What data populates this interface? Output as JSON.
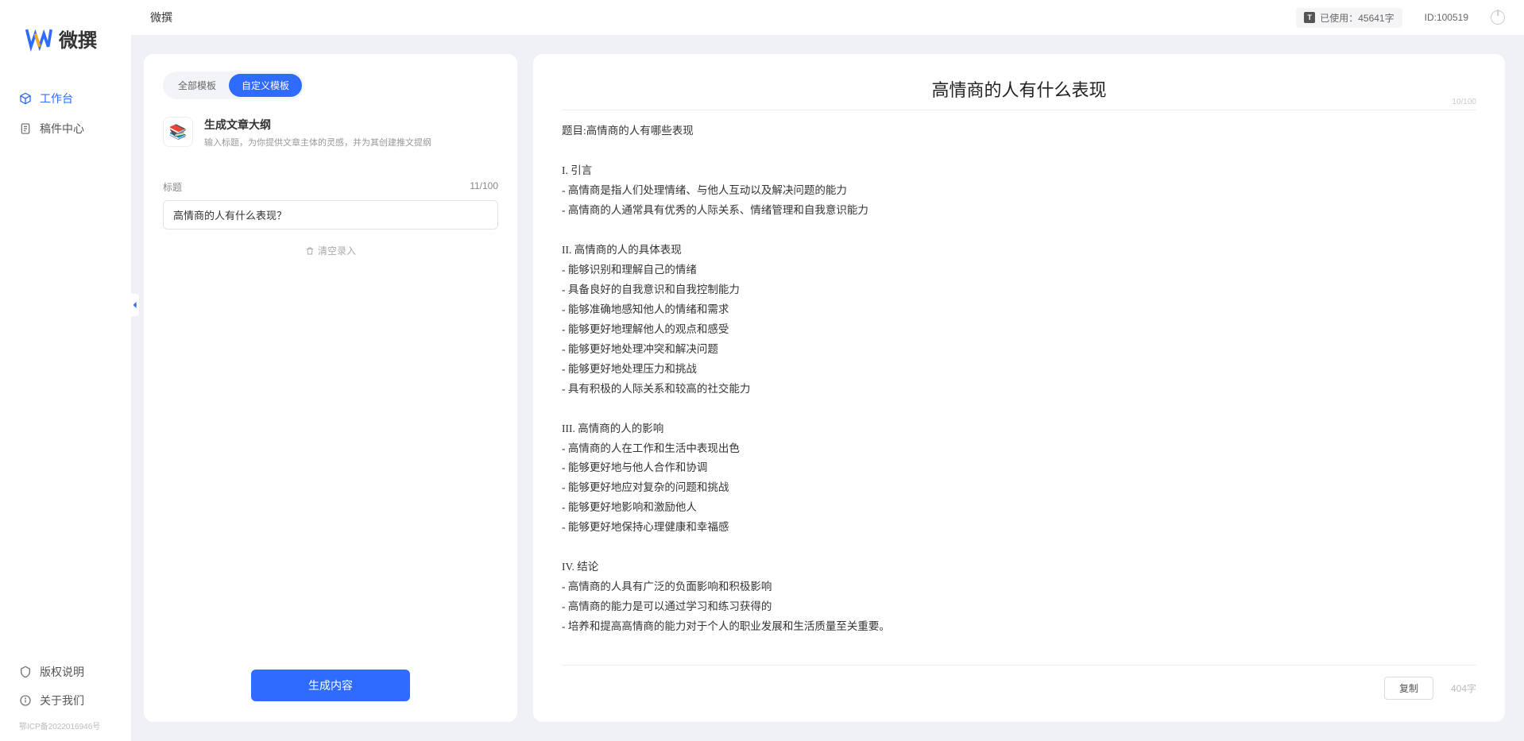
{
  "app": {
    "name": "微撰",
    "top_title": "微撰"
  },
  "sidebar": {
    "items": [
      {
        "label": "工作台",
        "active": true
      },
      {
        "label": "稿件中心",
        "active": false
      }
    ],
    "bottom": [
      {
        "label": "版权说明"
      },
      {
        "label": "关于我们"
      }
    ],
    "icp": "鄂ICP备2022016946号"
  },
  "topbar": {
    "usage_label": "已使用：45641字",
    "id_label": "ID:100519"
  },
  "left": {
    "tabs": [
      {
        "label": "全部模板",
        "active": false
      },
      {
        "label": "自定义模板",
        "active": true
      }
    ],
    "template": {
      "title": "生成文章大纲",
      "desc": "输入标题，为你提供文章主体的灵感，并为其创建推文提纲"
    },
    "field_label": "标题",
    "char_info": "11/100",
    "input_value": "高情商的人有什么表现？",
    "clear_text": "清空录入",
    "generate_label": "生成内容"
  },
  "right": {
    "title": "高情商的人有什么表现",
    "title_count": "10/100",
    "body": "题目:高情商的人有哪些表现\n\nI. 引言\n- 高情商是指人们处理情绪、与他人互动以及解决问题的能力\n- 高情商的人通常具有优秀的人际关系、情绪管理和自我意识能力\n\nII. 高情商的人的具体表现\n- 能够识别和理解自己的情绪\n- 具备良好的自我意识和自我控制能力\n- 能够准确地感知他人的情绪和需求\n- 能够更好地理解他人的观点和感受\n- 能够更好地处理冲突和解决问题\n- 能够更好地处理压力和挑战\n- 具有积极的人际关系和较高的社交能力\n\nIII. 高情商的人的影响\n- 高情商的人在工作和生活中表现出色\n- 能够更好地与他人合作和协调\n- 能够更好地应对复杂的问题和挑战\n- 能够更好地影响和激励他人\n- 能够更好地保持心理健康和幸福感\n\nIV. 结论\n- 高情商的人具有广泛的负面影响和积极影响\n- 高情商的能力是可以通过学习和练习获得的\n- 培养和提高高情商的能力对于个人的职业发展和生活质量至关重要。",
    "copy_label": "复制",
    "char_count": "404字"
  }
}
